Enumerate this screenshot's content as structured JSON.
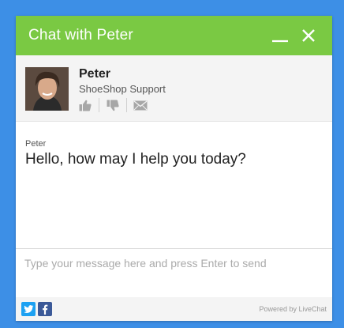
{
  "colors": {
    "page_bg": "#3d8fe6",
    "header": "#7ac943",
    "twitter": "#1da1f2",
    "facebook": "#3b5998"
  },
  "header": {
    "title": "Chat with Peter",
    "minimize_icon": "minimize-icon",
    "close_icon": "close-icon"
  },
  "agent": {
    "name": "Peter",
    "role": "ShoeShop Support",
    "actions": [
      "thumbs-up-icon",
      "thumbs-down-icon",
      "envelope-icon"
    ]
  },
  "messages": [
    {
      "author": "Peter",
      "text": "Hello, how may I help you today?"
    }
  ],
  "composer": {
    "placeholder": "Type your message here and press Enter to send",
    "value": ""
  },
  "footer": {
    "social": [
      "twitter-icon",
      "facebook-icon"
    ],
    "powered_by": "Powered by LiveChat"
  }
}
